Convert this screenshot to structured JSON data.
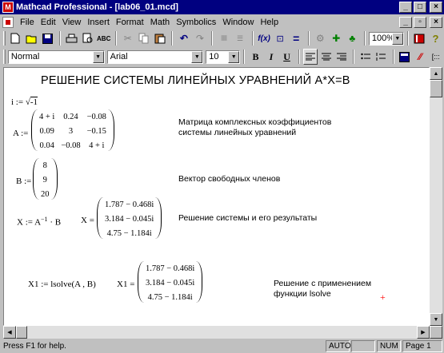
{
  "window": {
    "title": "Mathcad Professional - [lab06_01.mcd]"
  },
  "title_buttons": {
    "minimize": "_",
    "maximize": "□",
    "close": "×"
  },
  "doc_buttons": {
    "minimize": "_",
    "restore": "▫",
    "close": "×"
  },
  "menu": [
    {
      "label": "File"
    },
    {
      "label": "Edit"
    },
    {
      "label": "View"
    },
    {
      "label": "Insert"
    },
    {
      "label": "Format"
    },
    {
      "label": "Math"
    },
    {
      "label": "Symbolics"
    },
    {
      "label": "Window"
    },
    {
      "label": "Help"
    }
  ],
  "toolbar": {
    "zoom": "100%"
  },
  "format_bar": {
    "style": "Normal",
    "font": "Arial",
    "size": "10",
    "bold": "B",
    "italic": "I",
    "underline": "U"
  },
  "document": {
    "heading": "РЕШЕНИЕ СИСТЕМЫ ЛИНЕЙНЫХ УРАВНЕНИЙ А*Х=В",
    "i_def": {
      "lhs": "i :=",
      "arg": "-1"
    },
    "matrix_a": {
      "label": "A :=",
      "rows": [
        [
          "4 + i",
          "0.24",
          "−0.08"
        ],
        [
          "0.09",
          "3",
          "−0.15"
        ],
        [
          "0.04",
          "−0.08",
          "4 + i"
        ]
      ],
      "comment": "Матрица комплексных коэффициентов\nсистемы линейных уравнений"
    },
    "vector_b": {
      "label": "B :=",
      "rows": [
        "8",
        "9",
        "20"
      ],
      "comment": "Вектор свободных членов"
    },
    "solution": {
      "expr_lhs": "X := A",
      "expr_exp": "−1",
      "expr_rhs": "· B",
      "label": "X =",
      "rows": [
        "1.787 − 0.468i",
        "3.184 − 0.045i",
        "4.75 − 1.184i"
      ],
      "comment": "Решение системы и его результаты"
    },
    "lsolve": {
      "expr": "X1 := lsolve(A , B)",
      "label": "X1 =",
      "rows": [
        "1.787 − 0.468i",
        "3.184 − 0.045i",
        "4.75 − 1.184i"
      ],
      "comment": "Решение с применением\nфункции lsolve",
      "cursor": "+"
    }
  },
  "status": {
    "help": "Press F1 for help.",
    "auto": "AUTO",
    "num": "NUM",
    "page": "Page 1"
  },
  "colors": {
    "titlebar": "#000080",
    "face": "#c0c0c0",
    "cursor": "#ff0000"
  }
}
